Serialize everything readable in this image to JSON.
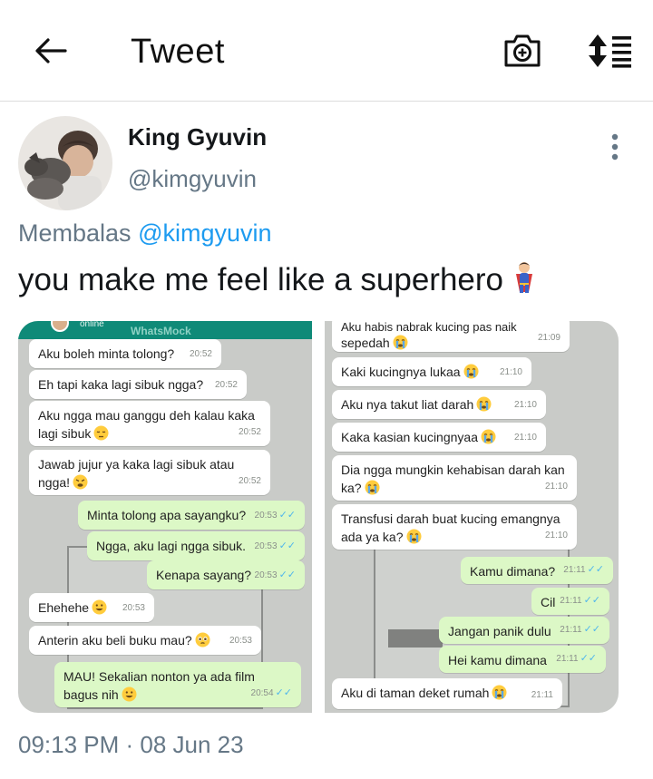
{
  "header": {
    "title": "Tweet"
  },
  "author": {
    "name": "King Gyuvin",
    "handle": "@kimgyuvin"
  },
  "reply": {
    "prefix": "Membalas",
    "mention": "@kimgyuvin"
  },
  "tweet": {
    "text": "you make me feel like a superhero",
    "emoji": "superhero-emoji"
  },
  "media": {
    "left": {
      "header": {
        "status": "online",
        "app": "WhatsMock"
      },
      "messages": [
        {
          "text": "Aku boleh minta tolong?",
          "time": "20:52"
        },
        {
          "text": "Eh tapi kaka lagi sibuk ngga?",
          "time": "20:52"
        },
        {
          "line1": "Aku ngga mau ganggu deh kalau kaka",
          "line2": "lagi sibuk",
          "time": "20:52"
        },
        {
          "line1": "Jawab jujur ya kaka lagi sibuk atau",
          "line2": "ngga!",
          "time": "20:52"
        },
        {
          "text": "Minta tolong apa sayangku?",
          "time": "20:53"
        },
        {
          "text": "Ngga, aku lagi ngga sibuk.",
          "time": "20:53"
        },
        {
          "text": "Kenapa sayang?",
          "time": "20:53"
        },
        {
          "text": "Ehehehe",
          "time": "20:53"
        },
        {
          "text": "Anterin aku beli buku mau?",
          "time": "20:53"
        },
        {
          "line1": "MAU! Sekalian nonton ya ada film",
          "line2": "bagus nih",
          "time": "20:54"
        }
      ]
    },
    "right": {
      "messages": [
        {
          "line1": "Aku habis nabrak kucing pas naik",
          "line2": "sepedah",
          "time": "21:09"
        },
        {
          "text": "Kaki kucingnya lukaa",
          "time": "21:10"
        },
        {
          "text": "Aku nya takut liat darah",
          "time": "21:10"
        },
        {
          "text": "Kaka kasian kucingnyaa",
          "time": "21:10"
        },
        {
          "line1": "Dia ngga mungkin kehabisan darah kan",
          "line2": "ka?",
          "time": "21:10"
        },
        {
          "line1": "Transfusi darah buat kucing emangnya",
          "line2": "ada ya ka?",
          "time": "21:10"
        },
        {
          "text": "Kamu dimana?",
          "time": "21:11"
        },
        {
          "text": "Cil",
          "time": "21:11"
        },
        {
          "text": "Jangan panik dulu",
          "time": "21:11"
        },
        {
          "text": "Hei kamu dimana",
          "time": "21:11"
        },
        {
          "text": "Aku di taman deket rumah",
          "time": "21:11"
        }
      ]
    }
  },
  "footer": {
    "timestamp": "09:13 PM · 08 Jun 23"
  },
  "colors": {
    "accent": "#1d9bf0",
    "secondary_text": "#657786",
    "chat_out": "#dcf8c6",
    "chat_header": "#0f8a78"
  },
  "icons": [
    "back-arrow-icon",
    "camera-plus-icon",
    "sort-icon",
    "more-vertical-icon"
  ]
}
